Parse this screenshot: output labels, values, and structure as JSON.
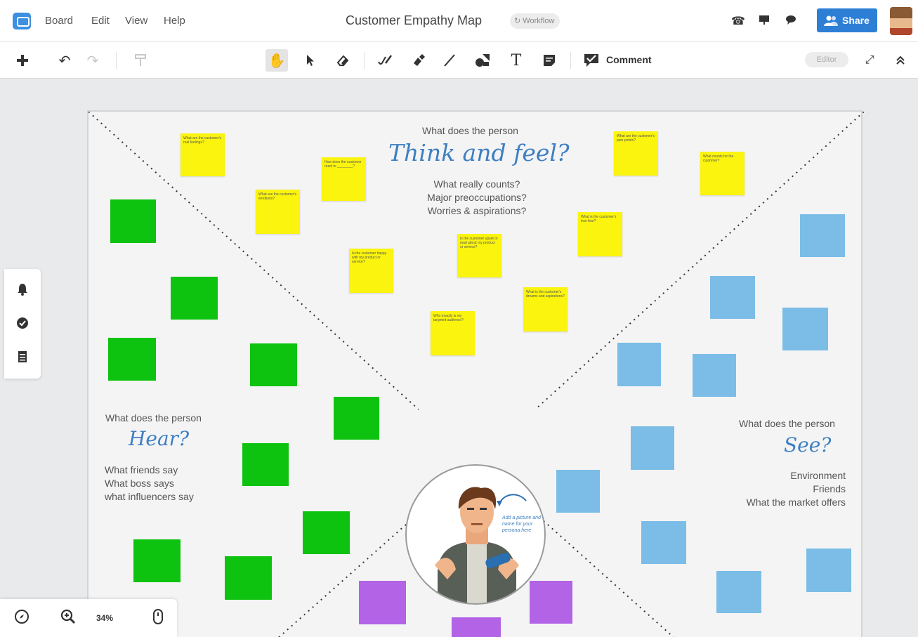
{
  "topbar": {
    "menu": [
      "Board",
      "Edit",
      "View",
      "Help"
    ],
    "title": "Customer Empathy Map",
    "workflow_label": "Workflow",
    "share_label": "Share",
    "icons": [
      "phone-icon",
      "present-icon",
      "chat-icon"
    ]
  },
  "toolbar": {
    "comment_label": "Comment",
    "editor_label": "Editor",
    "text_tool_glyph": "T"
  },
  "board": {
    "think": {
      "prompt": "What does the person",
      "heading": "Think and feel?",
      "items": [
        "What really counts?",
        "Major preoccupations?",
        "Worries & aspirations?"
      ]
    },
    "hear": {
      "prompt": "What does the person",
      "heading": "Hear?",
      "items": [
        "What friends say",
        "What boss says",
        "what influencers say"
      ]
    },
    "see": {
      "prompt": "What does the person",
      "heading": "See?",
      "items": [
        "Environment",
        "Friends",
        "What the market offers"
      ]
    },
    "stickies": [
      "What are the customer's real feelings?",
      "How does the customer react to ________?",
      "What are the customer's emotions?",
      "What are the customer's pain points?",
      "What counts for the customer?",
      "What is the customer's true fear?",
      "Is the customer happy with my product or service?",
      "Is the customer upset or mad about my product or service?",
      "What is the customer's dreams and aspirations?",
      "Who exactly is my targeted audience?"
    ],
    "persona_note": "Add a picture and name for your persona here"
  },
  "zoom": {
    "label": "34%"
  },
  "colors": {
    "accent": "#2d7fd6",
    "sticky_yellow": "#fbf40e",
    "green": "#0ec30f",
    "blue": "#7bbde6",
    "purple": "#b363e6",
    "script_blue": "#3e7fc1"
  }
}
